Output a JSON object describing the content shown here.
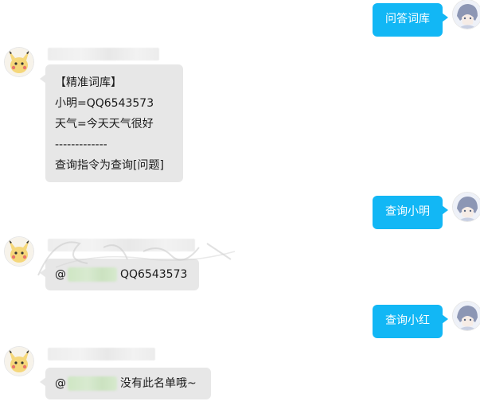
{
  "messages": [
    {
      "sender": "self",
      "text": "问答词库"
    },
    {
      "sender": "bot",
      "lines": [
        "【精准词库】",
        "小明=QQ6543573",
        "天气=今天天气很好",
        "-------------",
        "查询指令为查询[问题]"
      ]
    },
    {
      "sender": "self",
      "text": "查询小明"
    },
    {
      "sender": "bot",
      "at": "@",
      "text": "QQ6543573"
    },
    {
      "sender": "self",
      "text": "查询小红"
    },
    {
      "sender": "bot",
      "at": "@",
      "text": "没有此名单哦~"
    }
  ],
  "colors": {
    "self_bubble": "#12b7f5",
    "bot_bubble": "#e7e7e7"
  },
  "icons": {
    "self_avatar": "anime-character-avatar-icon",
    "bot_avatar": "pikachu-avatar-icon"
  }
}
